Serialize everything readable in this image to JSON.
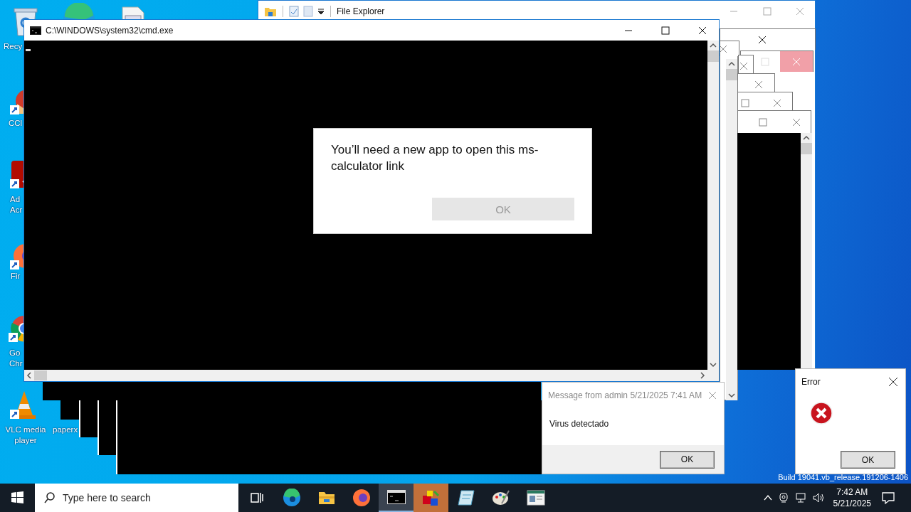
{
  "desktop_icons": [
    {
      "kind": "recycle",
      "lines": [
        "Recy"
      ]
    },
    {
      "kind": "edge"
    },
    {
      "kind": "file"
    },
    {
      "kind": "ccleaner",
      "lines": [
        "CCl"
      ]
    },
    {
      "kind": "acrobat",
      "lines": [
        "Ad",
        "Acr"
      ]
    },
    {
      "kind": "firefox",
      "lines": [
        "Fir"
      ]
    },
    {
      "kind": "chrome",
      "lines": [
        "Go",
        "Chr"
      ]
    },
    {
      "kind": "vlc",
      "lines": [
        "VLC media",
        "player"
      ]
    },
    {
      "kind": "hidden",
      "lines": [
        "paperx"
      ]
    }
  ],
  "file_explorer": {
    "title": "File Explorer"
  },
  "cmd_window": {
    "title": "C:\\WINDOWS\\system32\\cmd.exe"
  },
  "app_dialog": {
    "lines": [
      "You’ll need a new app to open this ms-",
      "calculator link"
    ],
    "button": {
      "label": "OK",
      "disabled": true
    }
  },
  "message_box": {
    "title": "Message from admin 5/21/2025 7:41 AM",
    "body": "Virus detectado",
    "button": "OK"
  },
  "error_box": {
    "title": "Error",
    "button": "OK"
  },
  "build_text": "Build 19041.vb_release.191206-1406",
  "taskbar": {
    "search": {
      "placeholder": "Type here to search"
    },
    "apps": [
      {
        "kind": "taskview",
        "selected": false,
        "flashing": false
      },
      {
        "kind": "edge",
        "selected": false,
        "flashing": false
      },
      {
        "kind": "explorer",
        "selected": false,
        "flashing": false
      },
      {
        "kind": "firefox",
        "selected": false,
        "flashing": false
      },
      {
        "kind": "cmd",
        "selected": true,
        "flashing": false
      },
      {
        "kind": "cubes",
        "selected": false,
        "flashing": true
      },
      {
        "kind": "notepad",
        "selected": false,
        "flashing": false
      },
      {
        "kind": "paint",
        "selected": false,
        "flashing": false
      },
      {
        "kind": "window",
        "selected": false,
        "flashing": false
      }
    ],
    "time": "7:42 AM",
    "date": "5/21/2025"
  }
}
